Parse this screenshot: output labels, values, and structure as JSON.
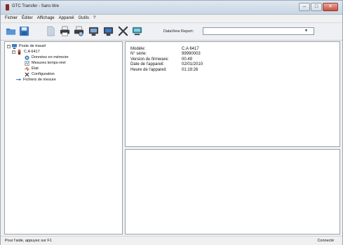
{
  "window": {
    "title": "GTC Transfer - Sans titre",
    "minimize": "–",
    "maximize": "□",
    "close": "✕"
  },
  "menu": [
    "Fichier",
    "Éditer",
    "Affichage",
    "Appareil",
    "Outils",
    "?"
  ],
  "toolbar": {
    "icons": [
      "open-folder-icon",
      "save-icon",
      "document-icon",
      "print-icon",
      "print-preview-icon",
      "device-settings-icon",
      "device-connect-icon",
      "tools-icon",
      "monitor-icon"
    ],
    "dataview_label": "DataView Report:",
    "dataview_value": ""
  },
  "tree": {
    "root": "Poste de travail",
    "device": "C.A 6417",
    "children": [
      "Données en mémoire",
      "Mesures temps-réel",
      "État",
      "Configuration"
    ],
    "files": "Fichiers de mesure"
  },
  "info": [
    {
      "key": "Modèle:",
      "value": "C.A 6417"
    },
    {
      "key": "N° série:",
      "value": "99990003"
    },
    {
      "key": "Version du firmware:",
      "value": "00.49"
    },
    {
      "key": "Date de l'appareil:",
      "value": "02/01/2010"
    },
    {
      "key": "Heure de l'appareil:",
      "value": "01:19:26"
    }
  ],
  "status": {
    "help": "Pour l'aide, appuyez sur F1",
    "connection": "Connecté"
  },
  "colors": {
    "toolbar_icon_blue": "#3b79c4",
    "toolbar_icon_dark": "#3a3f46",
    "accent_red": "#8b2a20"
  }
}
